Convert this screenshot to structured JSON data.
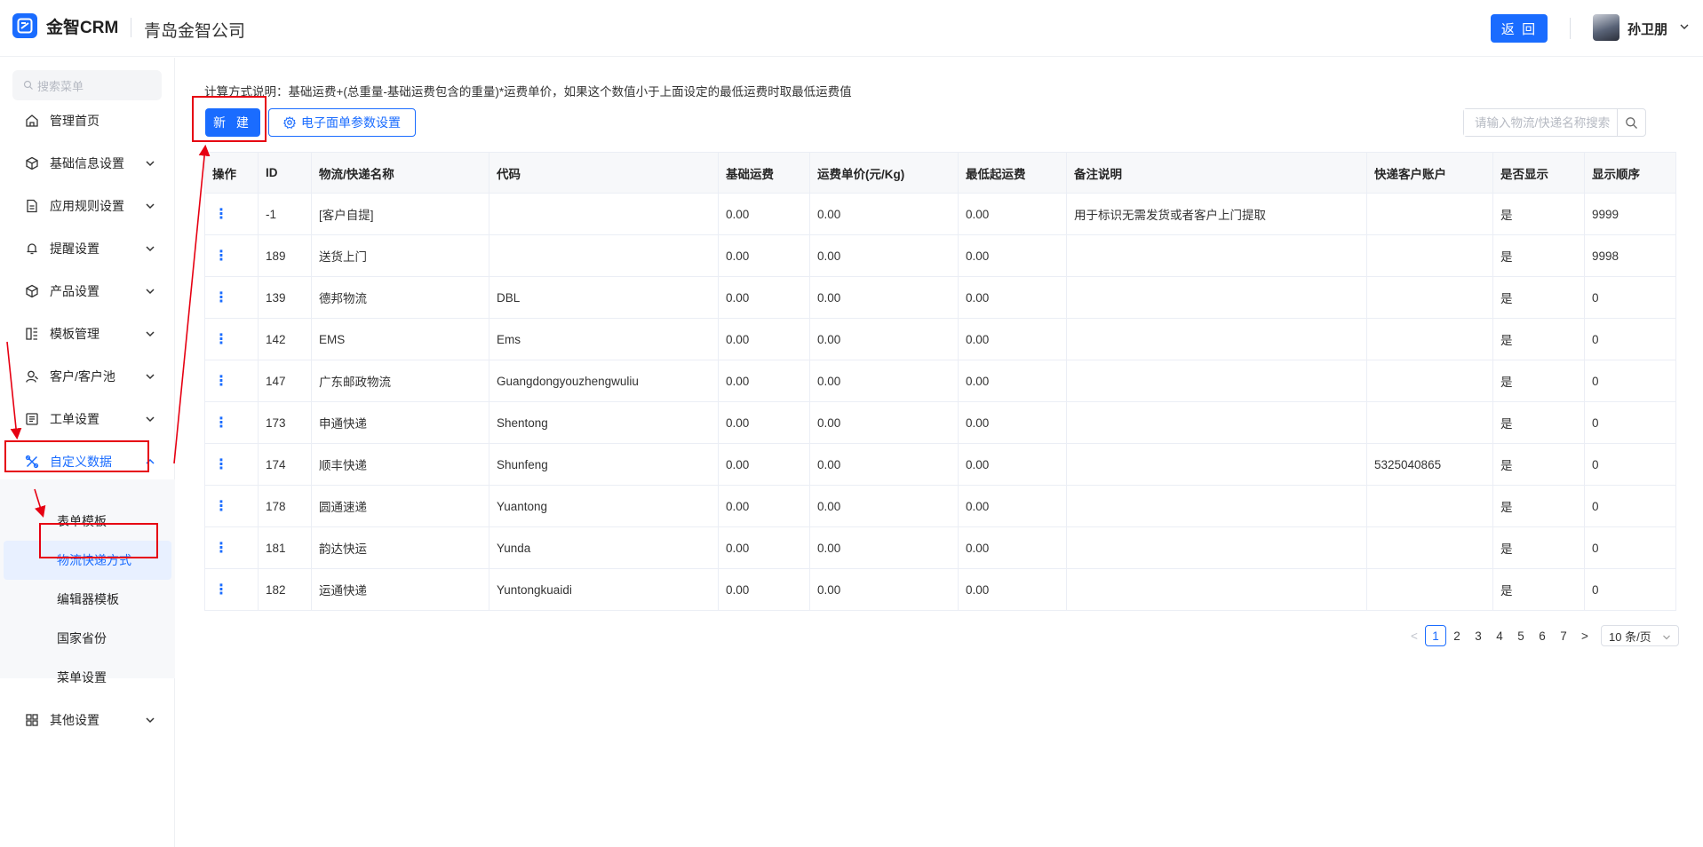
{
  "header": {
    "app_name": "金智CRM",
    "company": "青岛金智公司",
    "back_label": "返 回",
    "user_name": "孙卫朋"
  },
  "sidebar": {
    "search_placeholder": "搜索菜单",
    "items": [
      {
        "label": "管理首页",
        "icon": "home-icon"
      },
      {
        "label": "基础信息设置",
        "icon": "cube-icon"
      },
      {
        "label": "应用规则设置",
        "icon": "document-icon"
      },
      {
        "label": "提醒设置",
        "icon": "bell-icon"
      },
      {
        "label": "产品设置",
        "icon": "cube-icon"
      },
      {
        "label": "模板管理",
        "icon": "template-icon"
      },
      {
        "label": "客户/客户池",
        "icon": "user-icon"
      },
      {
        "label": "工单设置",
        "icon": "list-icon"
      },
      {
        "label": "自定义数据",
        "icon": "tools-icon"
      },
      {
        "label": "其他设置",
        "icon": "grid-icon"
      }
    ],
    "sub_items": [
      "表单模板",
      "物流快递方式",
      "编辑器模板",
      "国家省份",
      "菜单设置"
    ]
  },
  "main": {
    "calc_note": "计算方式说明：基础运费+(总重量-基础运费包含的重量)*运费单价，如果这个数值小于上面设定的最低运费时取最低运费值",
    "new_label": "新 建",
    "param_label": "电子面单参数设置",
    "search_placeholder": "请输入物流/快递名称搜索",
    "columns": [
      "操作",
      "ID",
      "物流/快递名称",
      "代码",
      "基础运费",
      "运费单价(元/Kg)",
      "最低起运费",
      "备注说明",
      "快递客户账户",
      "是否显示",
      "显示顺序"
    ],
    "rows": [
      [
        "⋮",
        "-1",
        "[客户自提]",
        "",
        "0.00",
        "0.00",
        "0.00",
        "用于标识无需发货或者客户上门提取",
        "",
        "是",
        "9999"
      ],
      [
        "⋮",
        "189",
        "送货上门",
        "",
        "0.00",
        "0.00",
        "0.00",
        "",
        "",
        "是",
        "9998"
      ],
      [
        "⋮",
        "139",
        "德邦物流",
        "DBL",
        "0.00",
        "0.00",
        "0.00",
        "",
        "",
        "是",
        "0"
      ],
      [
        "⋮",
        "142",
        "EMS",
        "Ems",
        "0.00",
        "0.00",
        "0.00",
        "",
        "",
        "是",
        "0"
      ],
      [
        "⋮",
        "147",
        "广东邮政物流",
        "Guangdongyouzhengwuliu",
        "0.00",
        "0.00",
        "0.00",
        "",
        "",
        "是",
        "0"
      ],
      [
        "⋮",
        "173",
        "申通快递",
        "Shentong",
        "0.00",
        "0.00",
        "0.00",
        "",
        "",
        "是",
        "0"
      ],
      [
        "⋮",
        "174",
        "顺丰快递",
        "Shunfeng",
        "0.00",
        "0.00",
        "0.00",
        "",
        "5325040865",
        "是",
        "0"
      ],
      [
        "⋮",
        "178",
        "圆通速递",
        "Yuantong",
        "0.00",
        "0.00",
        "0.00",
        "",
        "",
        "是",
        "0"
      ],
      [
        "⋮",
        "181",
        "韵达快运",
        "Yunda",
        "0.00",
        "0.00",
        "0.00",
        "",
        "",
        "是",
        "0"
      ],
      [
        "⋮",
        "182",
        "运通快递",
        "Yuntongkuaidi",
        "0.00",
        "0.00",
        "0.00",
        "",
        "",
        "是",
        "0"
      ]
    ],
    "pagination": {
      "prev": "<",
      "next": ">",
      "pages": [
        "1",
        "2",
        "3",
        "4",
        "5",
        "6",
        "7"
      ],
      "current": "1",
      "page_size": "10 条/页"
    }
  },
  "colors": {
    "accent": "#1a6cff",
    "annotation": "#e60012"
  }
}
